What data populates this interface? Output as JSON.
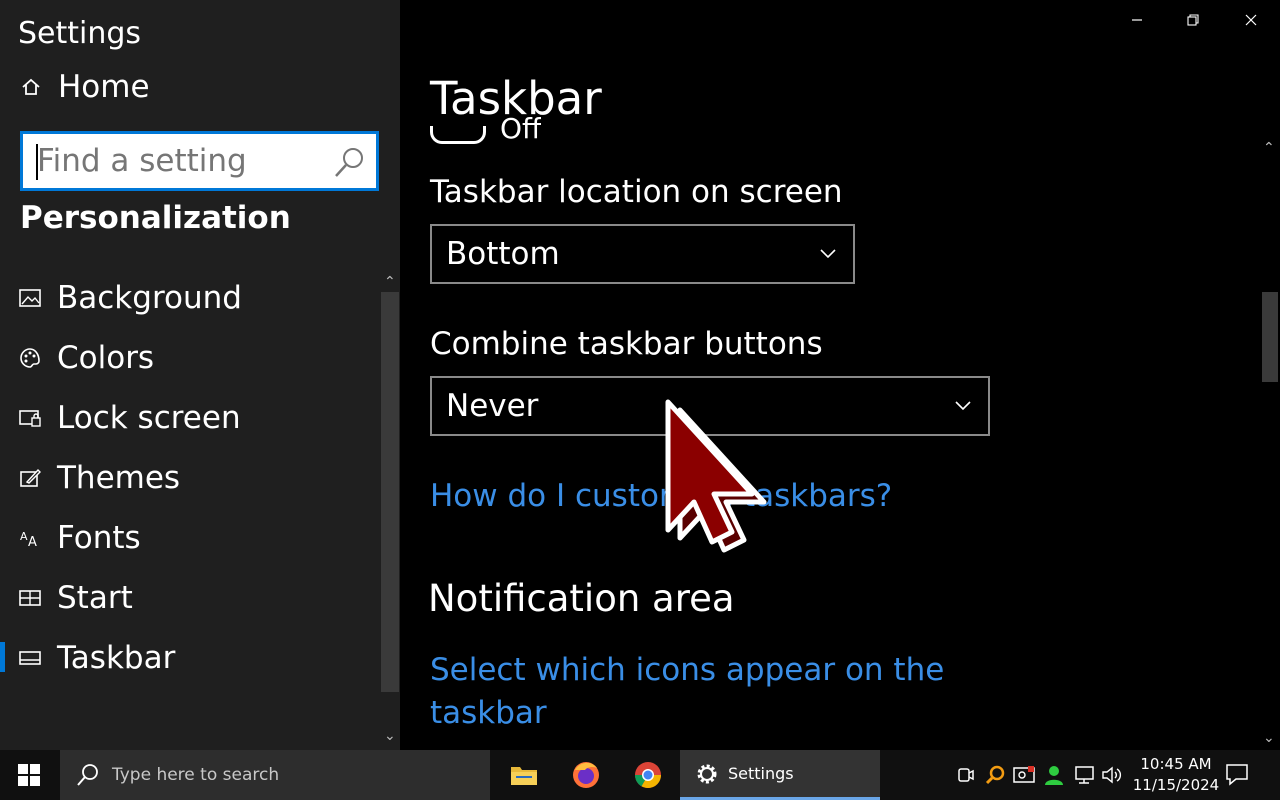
{
  "window": {
    "app_title": "Settings",
    "controls": {
      "minimize": "minimize",
      "restore": "restore",
      "close": "close"
    }
  },
  "sidebar": {
    "home_label": "Home",
    "search": {
      "placeholder": "Find a setting",
      "value": ""
    },
    "section_title": "Personalization",
    "items": [
      {
        "label": "Background",
        "icon": "image-icon"
      },
      {
        "label": "Colors",
        "icon": "palette-icon"
      },
      {
        "label": "Lock screen",
        "icon": "lock-screen-icon"
      },
      {
        "label": "Themes",
        "icon": "themes-icon"
      },
      {
        "label": "Fonts",
        "icon": "fonts-icon"
      },
      {
        "label": "Start",
        "icon": "start-icon"
      },
      {
        "label": "Taskbar",
        "icon": "taskbar-icon",
        "selected": true
      }
    ]
  },
  "content": {
    "page_title": "Taskbar",
    "toggle_state_partial": "Off",
    "location": {
      "label": "Taskbar location on screen",
      "value": "Bottom"
    },
    "combine": {
      "label": "Combine taskbar buttons",
      "value": "Never"
    },
    "customize_link": "How do I customize taskbars?",
    "notification_heading": "Notification area",
    "select_icons_link_line1": "Select which icons appear on the",
    "select_icons_link_line2": "taskbar"
  },
  "taskbar": {
    "search_placeholder": "Type here to search",
    "apps": [
      "file-explorer-icon",
      "firefox-icon",
      "chrome-icon"
    ],
    "active_app_label": "Settings",
    "time": "10:45 AM",
    "date": "11/15/2024"
  },
  "colors": {
    "accent": "#0078d7",
    "link": "#3a8ee6",
    "sidebar_bg": "#1f1f1f",
    "content_bg": "#000000",
    "cursor": "#8b0000"
  }
}
